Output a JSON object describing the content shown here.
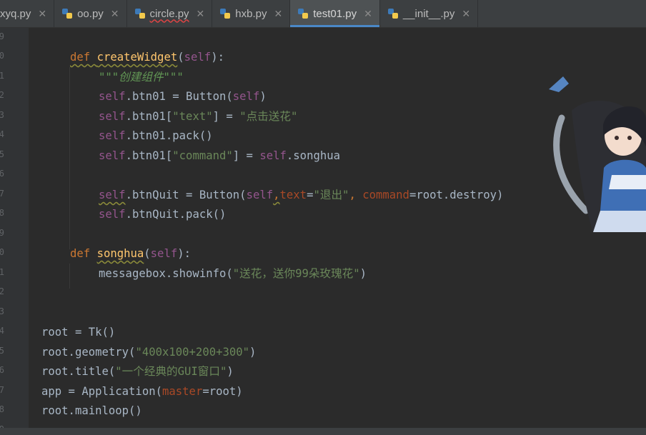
{
  "tabs": [
    {
      "name": "xyq.py",
      "close": "✕",
      "active": false,
      "error": false
    },
    {
      "name": "oo.py",
      "close": "✕",
      "active": false,
      "error": false
    },
    {
      "name": "circle.py",
      "close": "✕",
      "active": false,
      "error": true
    },
    {
      "name": "hxb.py",
      "close": "✕",
      "active": false,
      "error": false
    },
    {
      "name": "test01.py",
      "close": "✕",
      "active": true,
      "error": false
    },
    {
      "name": "__init__.py",
      "close": "✕",
      "active": false,
      "error": false
    }
  ],
  "gutter_numbers": [
    "9",
    "0",
    "1",
    "2",
    "3",
    "4",
    "5",
    "6",
    "7",
    "8",
    "9",
    "0",
    "1",
    "2",
    "3",
    "4",
    "5",
    "6",
    "7",
    "8",
    "9"
  ],
  "code": {
    "l1": {
      "kw": "def ",
      "fn": "createWidget",
      "p1": "(",
      "self": "self",
      "p2": "):"
    },
    "l2": {
      "doc": "\"\"\"创建组件\"\"\""
    },
    "l3": {
      "self": "self",
      "a": ".btn01 = Button(",
      "self2": "self",
      "b": ")"
    },
    "l4": {
      "self": "self",
      "a": ".btn01[",
      "s1": "\"text\"",
      "b": "] = ",
      "s2": "\"点击送花\""
    },
    "l5": {
      "self": "self",
      "a": ".btn01.pack()"
    },
    "l6": {
      "self": "self",
      "a": ".btn01[",
      "s1": "\"command\"",
      "b": "] = ",
      "self2": "self",
      "c": ".songhua"
    },
    "l7": {
      "self": "self",
      "a": ".btnQuit = Button(",
      "self2": "self",
      "comma": ",",
      "param1": "text",
      "eq1": "=",
      "s1": "\"退出\"",
      "c2": ", ",
      "param2": "command",
      "eq2": "=",
      "tail": "root.destroy)"
    },
    "l8": {
      "self": "self",
      "a": ".btnQuit.pack()"
    },
    "l9": {
      "kw": "def ",
      "fn": "songhua",
      "p1": "(",
      "self": "self",
      "p2": "):"
    },
    "l10": {
      "a": "messagebox.showinfo(",
      "s1": "\"送花，送你99朵玫瑰花\"",
      "b": ")"
    },
    "l11": {
      "a": "root = Tk()"
    },
    "l12": {
      "a": "root.geometry(",
      "s1": "\"400x100+200+300\"",
      "b": ")"
    },
    "l13": {
      "a": "root.title(",
      "s1": "\"一个经典的GUI窗口\"",
      "b": ")"
    },
    "l14": {
      "a": "app = Application(",
      "param": "master",
      "eq": "=",
      "b": "root)"
    },
    "l15": {
      "a": "root.mainloop()"
    }
  },
  "colors": {
    "keyword": "#cc7832",
    "function": "#ffc66d",
    "self": "#94558d",
    "string": "#6a8759",
    "docstring": "#629755",
    "param": "#aa4926",
    "text": "#a9b7c6",
    "background": "#2b2b2b",
    "tab_active_underline": "#4a88c7"
  }
}
